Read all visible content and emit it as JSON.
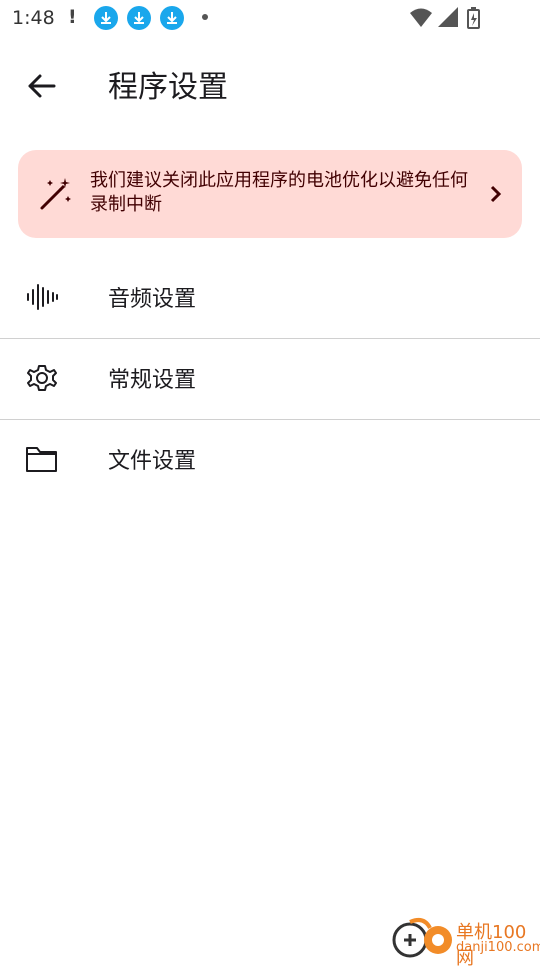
{
  "status_bar": {
    "time": "1:48",
    "alert": "!",
    "icons": [
      "download-icon",
      "download-icon",
      "download-icon",
      "dot",
      "wifi-icon",
      "cell-signal-icon",
      "battery-charging-icon"
    ]
  },
  "app_bar": {
    "title": "程序设置",
    "back_icon": "arrow-back-icon"
  },
  "banner": {
    "icon": "magic-wand-icon",
    "message": "我们建议关闭此应用程序的电池优化以避免任何录制中断",
    "chevron_icon": "chevron-right-icon",
    "background": "#ffdad6",
    "text_color": "#410002"
  },
  "settings": [
    {
      "icon": "audio-waveform-icon",
      "label": "音频设置"
    },
    {
      "icon": "gear-icon",
      "label": "常规设置"
    },
    {
      "icon": "folder-icon",
      "label": "文件设置"
    }
  ],
  "watermark": {
    "brand": "单机100网",
    "domain": "danji100.com"
  }
}
